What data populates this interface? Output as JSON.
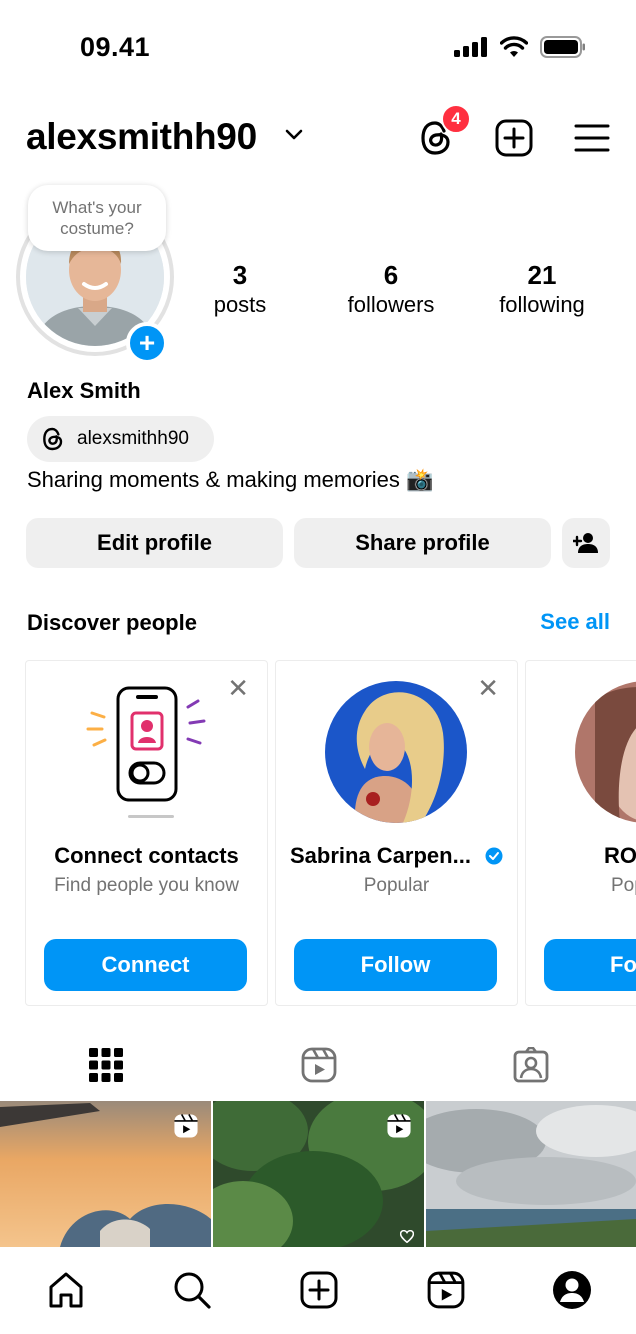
{
  "status_bar": {
    "time": "09.41"
  },
  "header": {
    "username": "alexsmithh90",
    "threads_badge_count": "4"
  },
  "profile": {
    "note": "What's your costume?",
    "stats": [
      {
        "value": "3",
        "label": "posts"
      },
      {
        "value": "6",
        "label": "followers"
      },
      {
        "value": "21",
        "label": "following"
      }
    ],
    "full_name": "Alex Smith",
    "threads_handle": "alexsmithh90",
    "bio": "Sharing moments & making memories 📸"
  },
  "actions": {
    "edit_label": "Edit profile",
    "share_label": "Share profile"
  },
  "discover": {
    "title": "Discover people",
    "see_all": "See all",
    "cards": [
      {
        "title": "Connect contacts",
        "subtitle": "Find people you know",
        "button": "Connect"
      },
      {
        "title": "Sabrina Carpen...",
        "subtitle": "Popular",
        "button": "Follow",
        "verified": true
      },
      {
        "title": "RO",
        "subtitle": "Pop",
        "button": "Fo"
      }
    ]
  },
  "colors": {
    "accent": "#0095f6",
    "badge": "#ff3040",
    "gray_button": "#efefef"
  },
  "icons": {
    "header": [
      "threads-icon",
      "new-post-icon",
      "menu-icon"
    ],
    "tabs": [
      "grid-icon",
      "reels-icon",
      "tagged-icon"
    ],
    "nav": [
      "home-icon",
      "search-icon",
      "create-icon",
      "reels-icon",
      "profile-icon"
    ]
  }
}
